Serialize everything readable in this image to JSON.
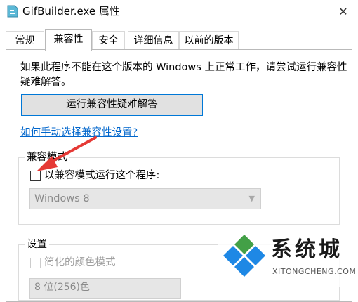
{
  "window": {
    "title": "GifBuilder.exe 属性",
    "close_glyph": "✕"
  },
  "tabs": [
    {
      "label": "常规",
      "active": false
    },
    {
      "label": "兼容性",
      "active": true
    },
    {
      "label": "安全",
      "active": false
    },
    {
      "label": "详细信息",
      "active": false
    },
    {
      "label": "以前的版本",
      "active": false
    }
  ],
  "compat": {
    "description": "如果此程序不能在这个版本的 Windows 上正常工作，请尝试运行兼容性疑难解答。",
    "run_troubleshooter_button": "运行兼容性疑难解答",
    "manual_link": "如何手动选择兼容性设置?",
    "mode_group": {
      "label": "兼容模式",
      "checkbox_label": "以兼容模式运行这个程序:",
      "checked": false,
      "os_select_value": "Windows 8"
    },
    "settings_group": {
      "label": "设置",
      "reduced_color_label": "简化的颜色模式",
      "color_select_value": "8 位(256)色"
    }
  },
  "watermark": {
    "brand": "系统城",
    "site": "XITONGCHENG.COM"
  },
  "colors": {
    "link": "#0066cc",
    "focus": "#0078d7",
    "arrow": "#e53935",
    "logo_blue": "#1e88e5",
    "logo_green": "#43a047"
  }
}
